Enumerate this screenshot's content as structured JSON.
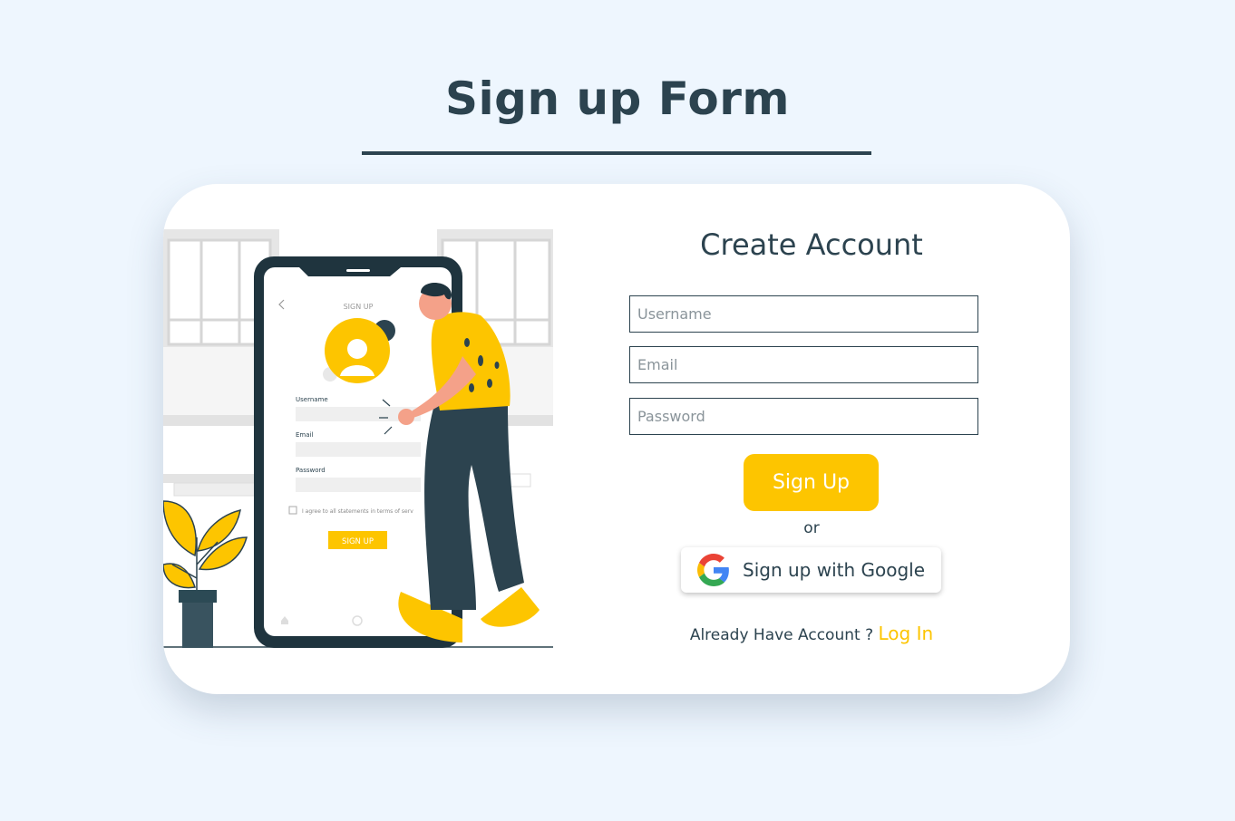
{
  "page": {
    "title": "Sign up Form"
  },
  "form": {
    "title": "Create Account",
    "username_placeholder": "Username",
    "email_placeholder": "Email",
    "password_placeholder": "Password",
    "signup_label": "Sign Up",
    "or_label": "or",
    "google_label": "Sign up with Google",
    "login_prompt": "Already Have Account ?",
    "login_link": "Log In"
  },
  "illustration": {
    "screen_title": "SIGN UP",
    "username_label": "Username",
    "email_label": "Email",
    "password_label": "Password",
    "agree_label": "I agree to all statements in terms of serv",
    "button_label": "SIGN UP"
  },
  "colors": {
    "accent": "#fdc500",
    "primary_text": "#2c434f",
    "background": "#eef6fe",
    "card": "#ffffff"
  },
  "icons": {
    "google": "google-g-icon"
  }
}
